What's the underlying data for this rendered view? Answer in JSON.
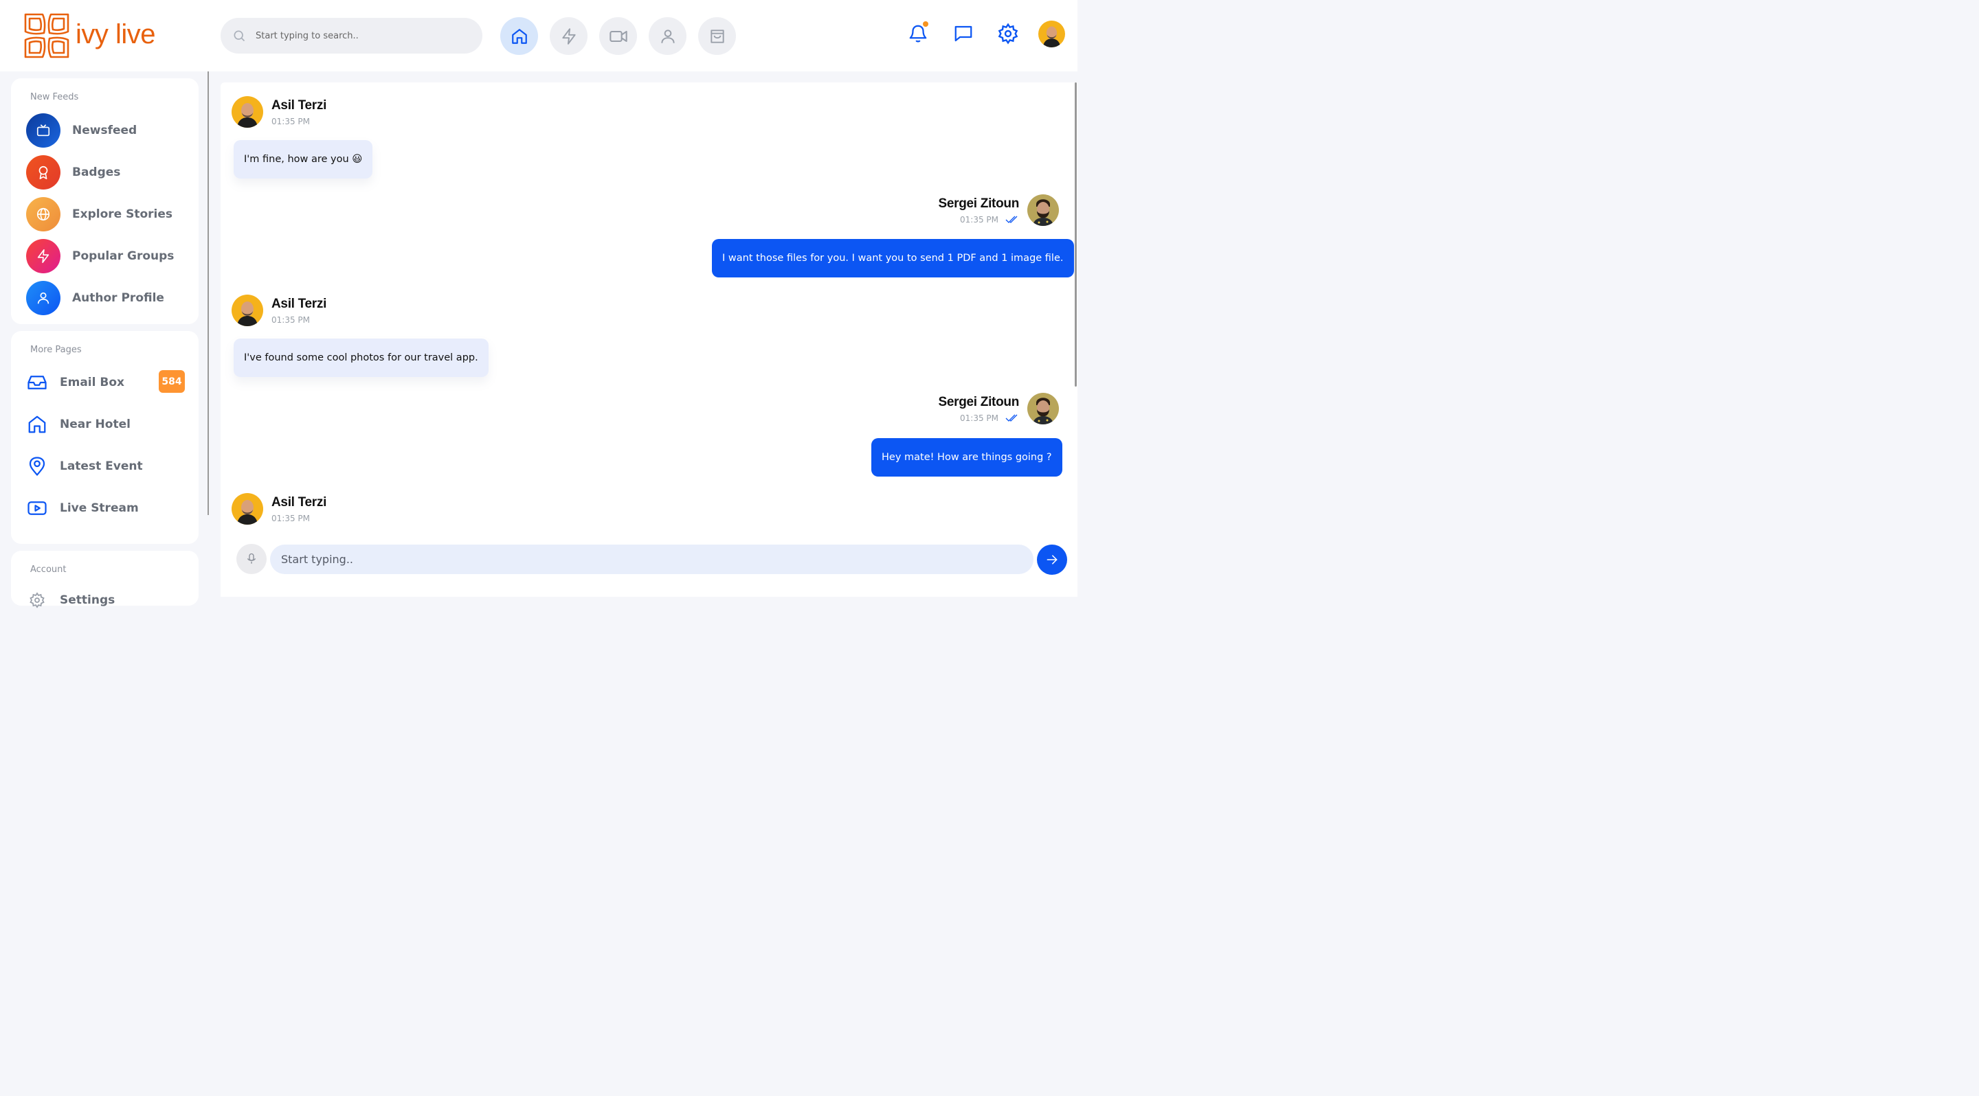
{
  "brand": {
    "name": "ivy live",
    "color": "#e8610e"
  },
  "search": {
    "placeholder": "Start typing to search.."
  },
  "top_nav": [
    {
      "icon": "home-icon",
      "active": true
    },
    {
      "icon": "lightning-icon",
      "active": false
    },
    {
      "icon": "video-icon",
      "active": false
    },
    {
      "icon": "user-icon",
      "active": false
    },
    {
      "icon": "shopping-bag-icon",
      "active": false
    }
  ],
  "top_right": {
    "icons": [
      "bell-icon",
      "chat-icon",
      "gear-icon"
    ],
    "notification_dot_color": "#f7931e"
  },
  "sidebar": {
    "feeds": {
      "title": "New Feeds",
      "items": [
        {
          "label": "Newsfeed",
          "icon": "tv-icon"
        },
        {
          "label": "Badges",
          "icon": "badge-icon"
        },
        {
          "label": "Explore Stories",
          "icon": "globe-icon"
        },
        {
          "label": "Popular Groups",
          "icon": "lightning-icon"
        },
        {
          "label": "Author Profile",
          "icon": "user-icon"
        }
      ]
    },
    "pages": {
      "title": "More Pages",
      "items": [
        {
          "label": "Email Box",
          "icon": "inbox-icon",
          "badge": "584"
        },
        {
          "label": "Near Hotel",
          "icon": "home-icon"
        },
        {
          "label": "Latest Event",
          "icon": "map-pin-icon"
        },
        {
          "label": "Live Stream",
          "icon": "youtube-icon"
        }
      ]
    },
    "account": {
      "title": "Account",
      "items": [
        {
          "label": "Settings",
          "icon": "gear-icon"
        }
      ]
    }
  },
  "chat": {
    "messages": [
      {
        "author": "Asil Terzi",
        "time": "01:35 PM",
        "text": "I'm fine, how are you 😃",
        "direction": "in"
      },
      {
        "author": "Sergei Zitoun",
        "time": "01:35 PM",
        "text": "I want those files for you. I want you to send 1 PDF and 1 image file.",
        "direction": "out",
        "read": true
      },
      {
        "author": "Asil Terzi",
        "time": "01:35 PM",
        "text": "I've found some cool photos for our travel app.",
        "direction": "in"
      },
      {
        "author": "Sergei Zitoun",
        "time": "01:35 PM",
        "text": "Hey mate! How are things going ?",
        "direction": "out",
        "read": true
      },
      {
        "author": "Asil Terzi",
        "time": "01:35 PM",
        "text": "",
        "direction": "in"
      }
    ],
    "composer": {
      "placeholder": "Start typing.."
    }
  },
  "colors": {
    "accent": "#0c56f3",
    "incoming_bubble": "#e8edfc",
    "badge": "#fe9431"
  }
}
